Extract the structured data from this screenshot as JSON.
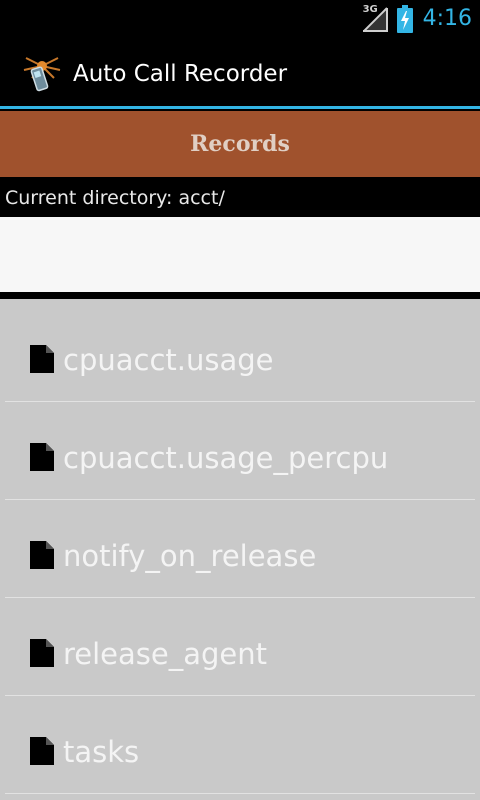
{
  "status_bar": {
    "network_type": "3G",
    "time": "4:16"
  },
  "action_bar": {
    "title": "Auto Call Recorder"
  },
  "records_tab": {
    "label": "Records"
  },
  "current_directory": {
    "text": "Current directory: acct/"
  },
  "files": [
    {
      "name": "cpuacct.usage"
    },
    {
      "name": "cpuacct.usage_percpu"
    },
    {
      "name": "notify_on_release"
    },
    {
      "name": "release_agent"
    },
    {
      "name": "tasks"
    }
  ],
  "colors": {
    "accent": "#33b5e5",
    "tab_background": "#a0522d",
    "list_background": "#c9c9c9"
  }
}
